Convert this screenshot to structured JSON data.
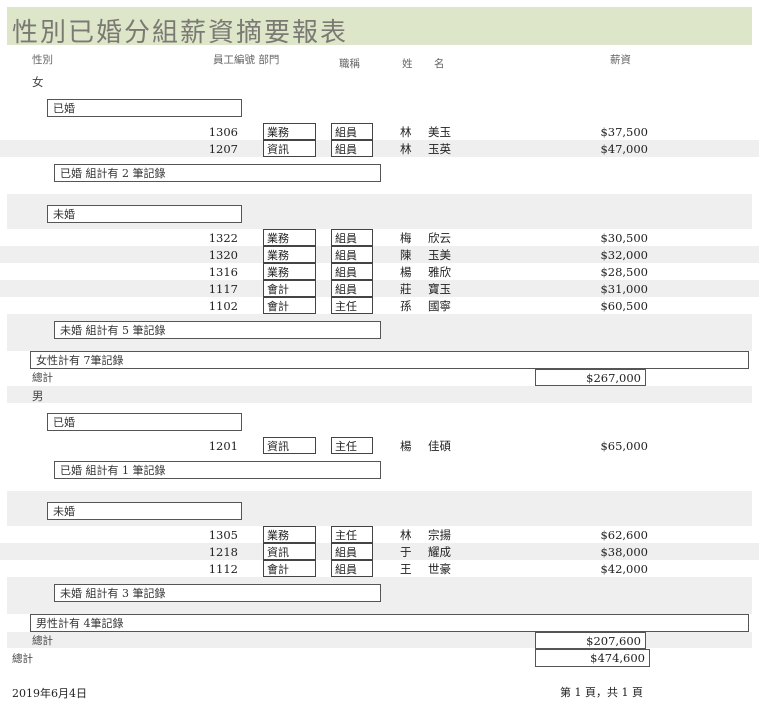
{
  "report": {
    "title": "性別已婚分組薪資摘要報表"
  },
  "headers": {
    "gender": "性別",
    "emp_dept": "員工編號 部門",
    "job": "職稱",
    "last": "姓",
    "first": "名",
    "salary": "薪資"
  },
  "groups": [
    {
      "gender": "女",
      "married": {
        "label": "已婚",
        "rows": [
          {
            "id": "1306",
            "dept": "業務",
            "job": "組員",
            "last": "林",
            "first": "美玉",
            "salary": "$37,500"
          },
          {
            "id": "1207",
            "dept": "資訊",
            "job": "組員",
            "last": "林",
            "first": "玉英",
            "salary": "$47,000"
          }
        ],
        "summary": "已婚 組計有 2 筆記錄"
      },
      "unmarried": {
        "label": "未婚",
        "rows": [
          {
            "id": "1322",
            "dept": "業務",
            "job": "組員",
            "last": "梅",
            "first": "欣云",
            "salary": "$30,500"
          },
          {
            "id": "1320",
            "dept": "業務",
            "job": "組員",
            "last": "陳",
            "first": "玉美",
            "salary": "$32,000"
          },
          {
            "id": "1316",
            "dept": "業務",
            "job": "組員",
            "last": "楊",
            "first": "雅欣",
            "salary": "$28,500"
          },
          {
            "id": "1117",
            "dept": "會計",
            "job": "組員",
            "last": "莊",
            "first": "寶玉",
            "salary": "$31,000"
          },
          {
            "id": "1102",
            "dept": "會計",
            "job": "主任",
            "last": "孫",
            "first": "國寧",
            "salary": "$60,500"
          }
        ],
        "summary": "未婚 組計有 5 筆記錄"
      },
      "gender_summary": "女性計有 7筆記錄",
      "total_label": "總計",
      "total": "$267,000"
    },
    {
      "gender": "男",
      "married": {
        "label": "已婚",
        "rows": [
          {
            "id": "1201",
            "dept": "資訊",
            "job": "主任",
            "last": "楊",
            "first": "佳碩",
            "salary": "$65,000"
          }
        ],
        "summary": "已婚 組計有 1 筆記錄"
      },
      "unmarried": {
        "label": "未婚",
        "rows": [
          {
            "id": "1305",
            "dept": "業務",
            "job": "主任",
            "last": "林",
            "first": "宗揚",
            "salary": "$62,600"
          },
          {
            "id": "1218",
            "dept": "資訊",
            "job": "組員",
            "last": "于",
            "first": "耀成",
            "salary": "$38,000"
          },
          {
            "id": "1112",
            "dept": "會計",
            "job": "組員",
            "last": "王",
            "first": "世豪",
            "salary": "$42,000"
          }
        ],
        "summary": "未婚 組計有 3 筆記錄"
      },
      "gender_summary": "男性計有 4筆記錄",
      "total_label": "總計",
      "total": "$207,600"
    }
  ],
  "grand_total": {
    "label": "總計",
    "value": "$474,600"
  },
  "footer": {
    "date": "2019年6月4日",
    "page": "第 1 頁，共 1 頁"
  }
}
